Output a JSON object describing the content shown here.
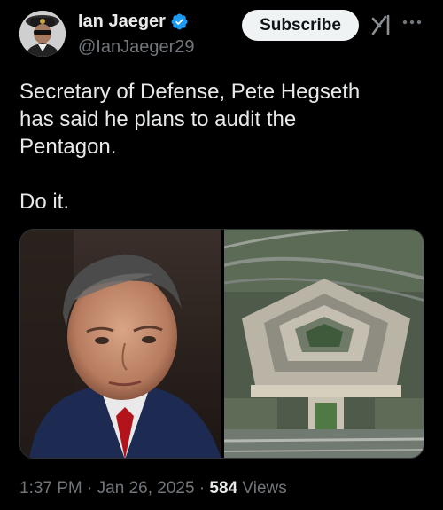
{
  "author": {
    "display_name": "Ian Jaeger",
    "handle": "@IanJaeger29",
    "verified_icon": "verified-badge-icon",
    "avatar_icon": "avatar"
  },
  "actions": {
    "subscribe_label": "Subscribe",
    "grok_icon": "grok-icon",
    "more_icon": "more-icon"
  },
  "tweet": {
    "text": "Secretary of Defense, Pete Hegseth\nhas said he plans to audit the\nPentagon.\n\nDo it."
  },
  "meta": {
    "time": "1:37 PM",
    "separator": " · ",
    "date": "Jan 26, 2025",
    "views_count": "584",
    "views_label": "Views"
  },
  "colors": {
    "background": "#000000",
    "text": "#e7e9ea",
    "secondary": "#71767b",
    "verified": "#1d9bf0",
    "button_bg": "#eff3f4"
  }
}
